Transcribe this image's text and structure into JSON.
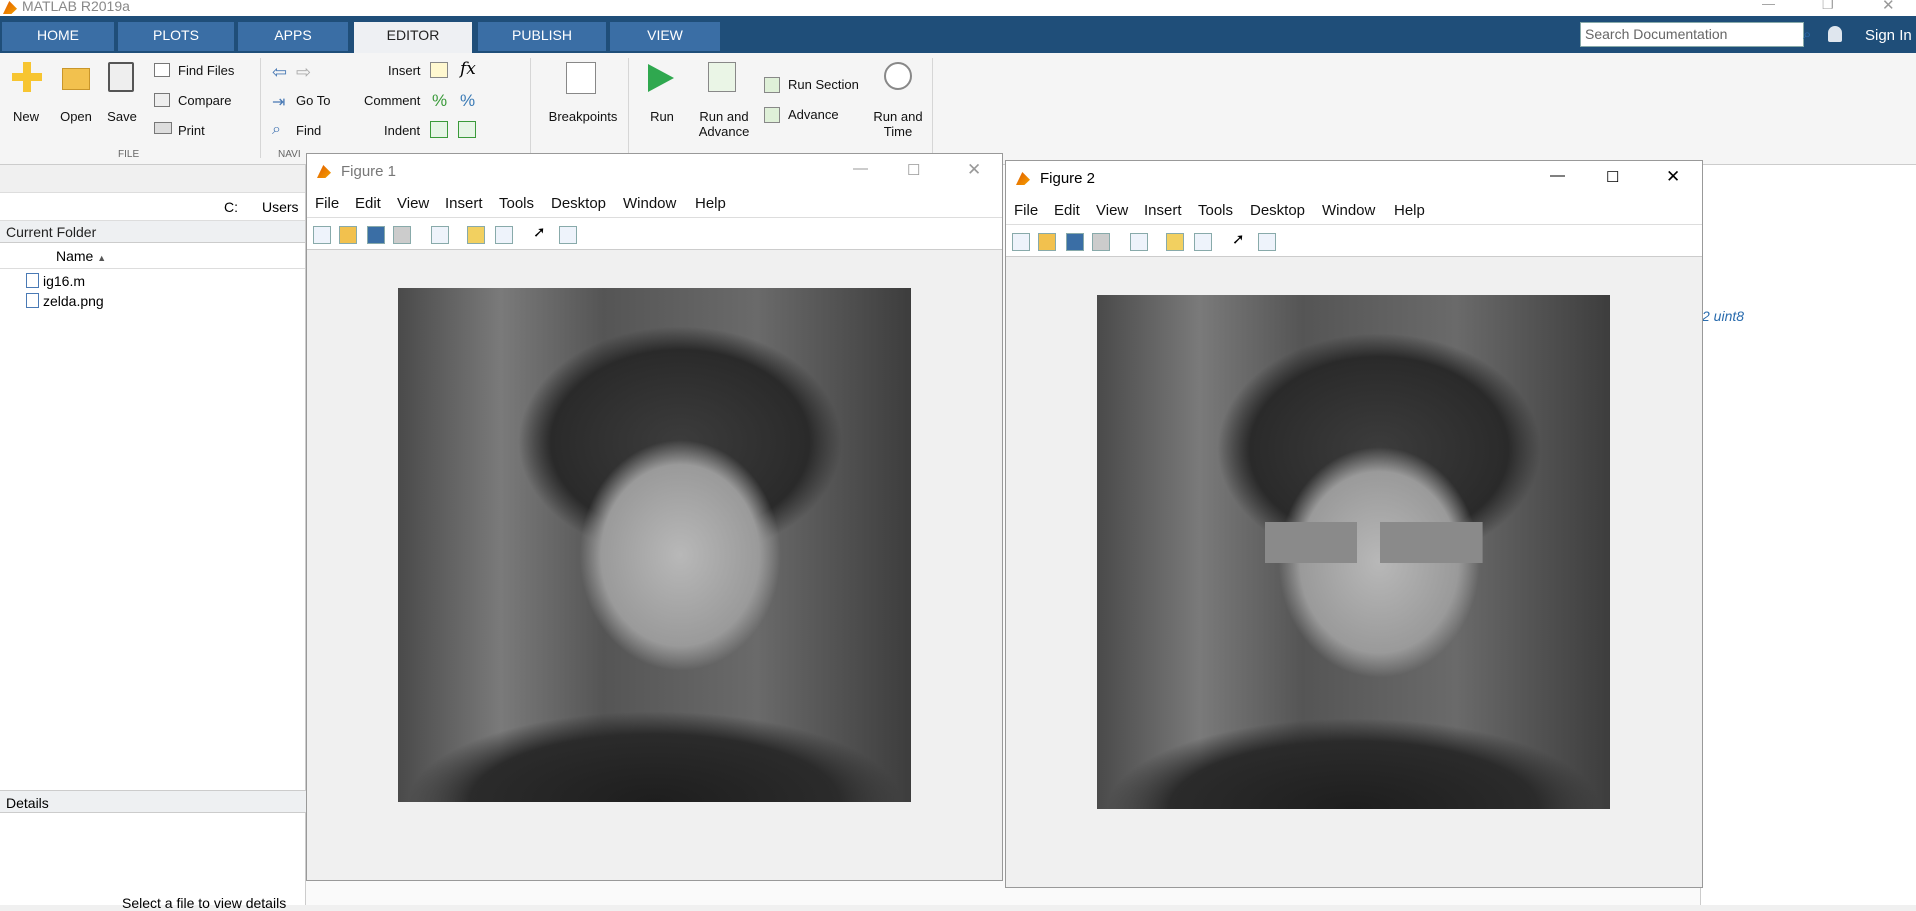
{
  "app": {
    "title": "MATLAB R2019a"
  },
  "tabs": [
    "HOME",
    "PLOTS",
    "APPS",
    "EDITOR",
    "PUBLISH",
    "VIEW"
  ],
  "search": {
    "placeholder": "Search Documentation"
  },
  "sign_in": "Sign In",
  "ribbon": {
    "file": {
      "new": "New",
      "open": "Open",
      "save": "Save",
      "find_files": "Find Files",
      "compare": "Compare",
      "print": "Print",
      "group": "FILE"
    },
    "navigate": {
      "go_to": "Go To",
      "find": "Find",
      "group": "NAVI"
    },
    "edit": {
      "insert": "Insert",
      "comment": "Comment",
      "indent": "Indent"
    },
    "breakpoints": "Breakpoints",
    "run": {
      "run": "Run",
      "run_advance": "Run and\nAdvance",
      "run_section": "Run Section",
      "advance": "Advance",
      "run_time": "Run and\nTime"
    }
  },
  "path": {
    "drive": "C:",
    "folder": "Users"
  },
  "current_folder": {
    "title": "Current Folder",
    "column": "Name",
    "files": [
      {
        "name": "ig16.m",
        "icon": "m-file-icon"
      },
      {
        "name": "zelda.png",
        "icon": "image-file-icon"
      }
    ]
  },
  "details": {
    "title": "Details",
    "hint": "Select a file to view details"
  },
  "workspace_fragment": "2 uint8",
  "figure1": {
    "title": "Figure 1",
    "menu": [
      "File",
      "Edit",
      "View",
      "Insert",
      "Tools",
      "Desktop",
      "Window",
      "Help"
    ]
  },
  "figure2": {
    "title": "Figure 2",
    "menu": [
      "File",
      "Edit",
      "View",
      "Insert",
      "Tools",
      "Desktop",
      "Window",
      "Help"
    ]
  },
  "colors": {
    "tabbar": "#1f4e79",
    "tab": "#3a6ea5",
    "active_tab": "#eef0f3"
  }
}
